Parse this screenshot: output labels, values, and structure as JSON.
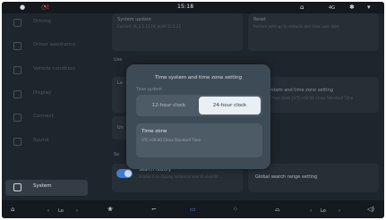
{
  "status_bar": {
    "time": "15:18",
    "icons": [
      "account-icon",
      "alert-icon",
      "home-icon",
      "network-icon",
      "bluetooth-icon",
      "wifi-icon"
    ],
    "alert_color": "#e04b4b"
  },
  "sidebar": {
    "items": [
      {
        "label": "Driving",
        "icon": "car-icon"
      },
      {
        "label": "Driver assistance",
        "icon": "assist-icon"
      },
      {
        "label": "Vehicle condition",
        "icon": "vehicle-icon"
      },
      {
        "label": "Display",
        "icon": "display-icon"
      },
      {
        "label": "Connect",
        "icon": "connect-icon"
      },
      {
        "label": "Sound",
        "icon": "sound-icon"
      },
      {
        "label": "System",
        "icon": "gear-icon"
      }
    ],
    "active_index": 6
  },
  "main": {
    "system_update": {
      "title": "System update",
      "subtitle": "Current: AI_3.1.15.24_build 15.5.25"
    },
    "reset": {
      "title": "Reset",
      "subtitle": "Restore settings to defaults and clear user data"
    },
    "section_use": "Use",
    "lo_card": {
      "title": "La"
    },
    "un_card": {
      "title": "Un"
    },
    "time_zone_card": {
      "title": "System and time zone setting",
      "subtitle": "24-hour clock | UTC+08:00 China Standard Time"
    },
    "section_search": "Se",
    "search_history": {
      "title": "Search history",
      "subtitle": "Enable it to display historical search records"
    },
    "global_search": {
      "title": "Global search range setting"
    }
  },
  "dialog": {
    "title": "Time system and time zone setting",
    "time_system_label": "Time system",
    "options": [
      "12-hour clock",
      "24-hour clock"
    ],
    "selected_option": "24-hour clock",
    "time_zone_label": "Time zone",
    "time_zone_value": "UTC+08:00 China Standard Time",
    "accent": "#e9eff3"
  },
  "bottom_bar": {
    "left_temp": "Lo",
    "right_temp": "Lo",
    "accent": "#4f86d8"
  }
}
